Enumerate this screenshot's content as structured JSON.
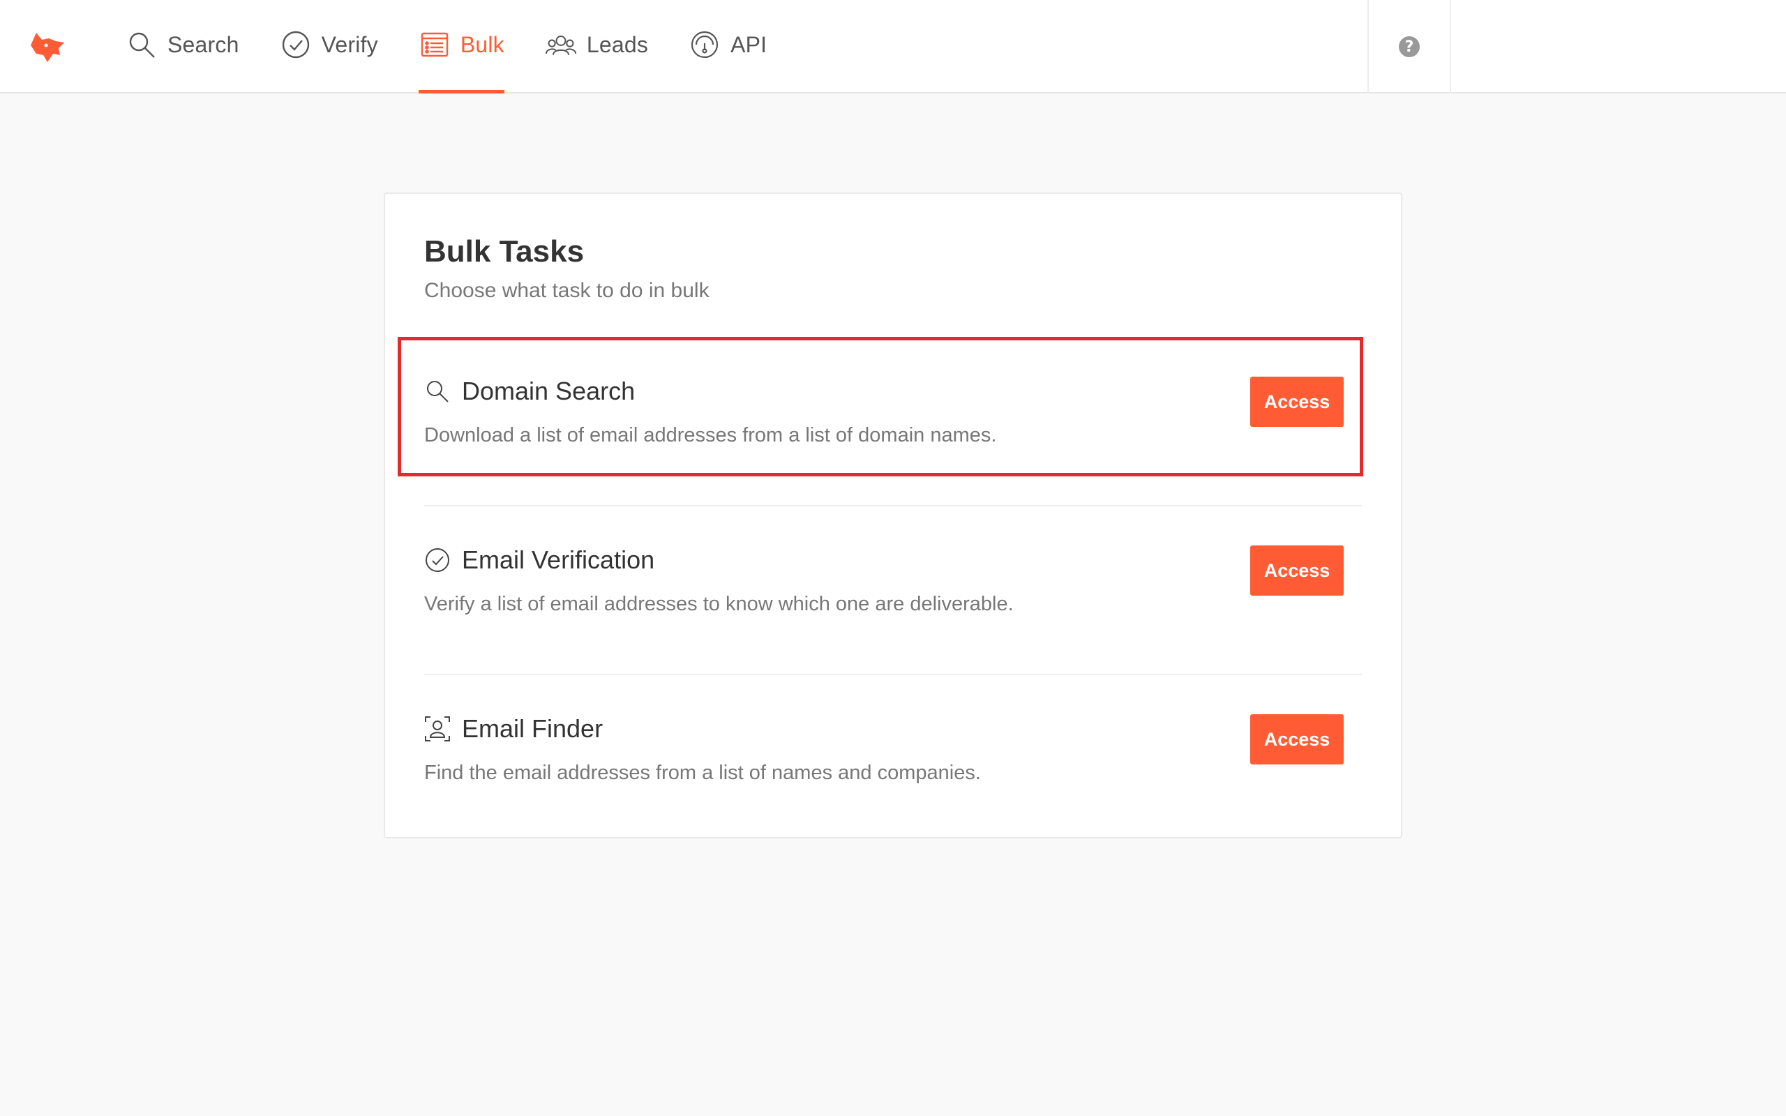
{
  "nav": {
    "items": [
      {
        "label": "Search",
        "icon": "search-icon"
      },
      {
        "label": "Verify",
        "icon": "check-circle-icon"
      },
      {
        "label": "Bulk",
        "icon": "list-icon",
        "active": true
      },
      {
        "label": "Leads",
        "icon": "people-icon"
      },
      {
        "label": "API",
        "icon": "gauge-icon"
      }
    ],
    "help": "?"
  },
  "card": {
    "title": "Bulk Tasks",
    "subtitle": "Choose what task to do in bulk",
    "tasks": [
      {
        "name": "Domain Search",
        "description": "Download a list of email addresses from a list of domain names.",
        "button": "Access",
        "icon": "search-icon"
      },
      {
        "name": "Email Verification",
        "description": "Verify a list of email addresses to know which one are deliverable.",
        "button": "Access",
        "icon": "check-circle-icon"
      },
      {
        "name": "Email Finder",
        "description": "Find the email addresses from a list of names and companies.",
        "button": "Access",
        "icon": "person-frame-icon"
      }
    ]
  },
  "colors": {
    "accent": "#ff5c35",
    "highlight": "#e62a2a"
  }
}
